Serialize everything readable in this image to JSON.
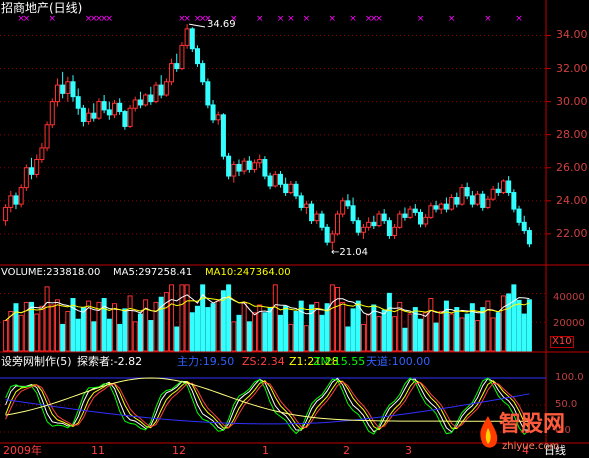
{
  "window": {
    "title": "招商地产(日线)"
  },
  "colors": {
    "up": "#ff3333",
    "down": "#33ffff",
    "grid": "#8b0000",
    "axis": "#c00000",
    "ma5": "#ffffff",
    "ma10": "#ffff00",
    "marker": "#ff00ff",
    "k": "#ffffff",
    "d": "#ffff00",
    "j": "#ff00ff",
    "z1": "#00ff00",
    "zm": "#ff4040",
    "ave": "#3030ff"
  },
  "price_panel": {
    "ticks": [
      "34.00",
      "32.00",
      "30.00",
      "28.00",
      "26.00",
      "24.00",
      "22.00"
    ],
    "high_label": "34.69",
    "low_label": "←21.04"
  },
  "volume_panel": {
    "label": "VOLUME:233818.00",
    "ma5_label": "MA5:297258.41",
    "ma10_label": "MA10:247364.00",
    "ticks": [
      "40000",
      "20000"
    ],
    "unit": "X10"
  },
  "indicator_panel": {
    "name": "设旁网制作(5)",
    "tansuo": "探索者:-2.82",
    "zhuli": "主力:19.50",
    "zs": "ZS:2.34",
    "z1": "Z1:21.28",
    "zm": "ZM:15.55",
    "tiandi": "天道:100.00",
    "ticks": [
      "100.0",
      "50.0",
      "0.0"
    ]
  },
  "time_axis": {
    "labels": [
      "2009年",
      "11",
      "12",
      "1",
      "2",
      "3",
      "4"
    ],
    "period": "日线"
  },
  "watermark": {
    "brand": "智股网",
    "url": "zhiyue.com"
  },
  "chart_data": {
    "type": "candlestick",
    "title": "招商地产(日线)",
    "price_range": [
      20.3,
      35.3
    ],
    "y_ticks": [
      34,
      32,
      30,
      28,
      26,
      24,
      22
    ],
    "highest": 34.69,
    "lowest": 21.04,
    "candles": [
      {
        "o": 22.8,
        "h": 23.8,
        "l": 22.5,
        "c": 23.6
      },
      {
        "o": 23.6,
        "h": 24.6,
        "l": 23.3,
        "c": 24.3
      },
      {
        "o": 24.3,
        "h": 24.5,
        "l": 23.5,
        "c": 23.8
      },
      {
        "o": 23.8,
        "h": 25.0,
        "l": 23.6,
        "c": 24.8
      },
      {
        "o": 24.8,
        "h": 26.2,
        "l": 24.6,
        "c": 26.0
      },
      {
        "o": 26.0,
        "h": 26.6,
        "l": 25.3,
        "c": 25.6
      },
      {
        "o": 25.6,
        "h": 26.8,
        "l": 25.4,
        "c": 26.5
      },
      {
        "o": 26.5,
        "h": 27.5,
        "l": 26.3,
        "c": 27.2
      },
      {
        "o": 27.2,
        "h": 28.8,
        "l": 27.0,
        "c": 28.6
      },
      {
        "o": 28.6,
        "h": 30.2,
        "l": 28.4,
        "c": 30.0
      },
      {
        "o": 30.0,
        "h": 31.4,
        "l": 29.7,
        "c": 31.0
      },
      {
        "o": 31.0,
        "h": 31.8,
        "l": 30.2,
        "c": 30.5
      },
      {
        "o": 30.5,
        "h": 31.5,
        "l": 30.0,
        "c": 31.2
      },
      {
        "o": 31.2,
        "h": 31.6,
        "l": 30.0,
        "c": 30.3
      },
      {
        "o": 30.3,
        "h": 30.8,
        "l": 29.2,
        "c": 29.6
      },
      {
        "o": 29.6,
        "h": 29.8,
        "l": 28.5,
        "c": 28.8
      },
      {
        "o": 28.8,
        "h": 29.6,
        "l": 28.6,
        "c": 29.3
      },
      {
        "o": 29.3,
        "h": 29.9,
        "l": 28.8,
        "c": 29.0
      },
      {
        "o": 29.0,
        "h": 30.2,
        "l": 28.9,
        "c": 30.0
      },
      {
        "o": 30.0,
        "h": 30.4,
        "l": 29.3,
        "c": 29.5
      },
      {
        "o": 29.5,
        "h": 30.0,
        "l": 28.9,
        "c": 29.2
      },
      {
        "o": 29.2,
        "h": 30.1,
        "l": 29.0,
        "c": 29.9
      },
      {
        "o": 29.9,
        "h": 30.2,
        "l": 29.2,
        "c": 29.4
      },
      {
        "o": 29.4,
        "h": 29.5,
        "l": 28.3,
        "c": 28.5
      },
      {
        "o": 28.5,
        "h": 29.8,
        "l": 28.4,
        "c": 29.6
      },
      {
        "o": 29.6,
        "h": 30.3,
        "l": 29.4,
        "c": 30.1
      },
      {
        "o": 30.1,
        "h": 30.6,
        "l": 29.6,
        "c": 29.8
      },
      {
        "o": 29.8,
        "h": 30.5,
        "l": 29.7,
        "c": 30.4
      },
      {
        "o": 30.4,
        "h": 30.9,
        "l": 29.8,
        "c": 30.0
      },
      {
        "o": 30.0,
        "h": 31.2,
        "l": 29.9,
        "c": 31.0
      },
      {
        "o": 31.0,
        "h": 31.6,
        "l": 30.2,
        "c": 30.4
      },
      {
        "o": 30.4,
        "h": 31.4,
        "l": 30.3,
        "c": 31.2
      },
      {
        "o": 31.2,
        "h": 32.6,
        "l": 31.0,
        "c": 32.3
      },
      {
        "o": 32.3,
        "h": 32.9,
        "l": 31.8,
        "c": 32.0
      },
      {
        "o": 32.0,
        "h": 33.6,
        "l": 31.9,
        "c": 33.4
      },
      {
        "o": 33.4,
        "h": 34.69,
        "l": 33.2,
        "c": 34.4
      },
      {
        "o": 34.4,
        "h": 34.5,
        "l": 33.0,
        "c": 33.2
      },
      {
        "o": 33.2,
        "h": 33.4,
        "l": 32.1,
        "c": 32.3
      },
      {
        "o": 32.3,
        "h": 32.5,
        "l": 31.0,
        "c": 31.2
      },
      {
        "o": 31.2,
        "h": 31.4,
        "l": 29.6,
        "c": 29.8
      },
      {
        "o": 29.8,
        "h": 30.1,
        "l": 28.7,
        "c": 28.9
      },
      {
        "o": 28.9,
        "h": 29.4,
        "l": 28.6,
        "c": 29.2
      },
      {
        "o": 29.2,
        "h": 29.3,
        "l": 26.5,
        "c": 26.7
      },
      {
        "o": 26.7,
        "h": 26.9,
        "l": 25.3,
        "c": 25.5
      },
      {
        "o": 25.5,
        "h": 26.4,
        "l": 25.1,
        "c": 26.2
      },
      {
        "o": 26.2,
        "h": 26.5,
        "l": 25.5,
        "c": 25.8
      },
      {
        "o": 25.8,
        "h": 26.6,
        "l": 25.6,
        "c": 26.4
      },
      {
        "o": 26.4,
        "h": 26.7,
        "l": 25.7,
        "c": 25.9
      },
      {
        "o": 25.9,
        "h": 26.5,
        "l": 25.7,
        "c": 26.3
      },
      {
        "o": 26.3,
        "h": 26.8,
        "l": 26.0,
        "c": 26.5
      },
      {
        "o": 26.5,
        "h": 26.7,
        "l": 25.3,
        "c": 25.5
      },
      {
        "o": 25.5,
        "h": 25.7,
        "l": 24.7,
        "c": 24.9
      },
      {
        "o": 24.9,
        "h": 25.8,
        "l": 24.8,
        "c": 25.6
      },
      {
        "o": 25.6,
        "h": 25.8,
        "l": 24.8,
        "c": 25.0
      },
      {
        "o": 25.0,
        "h": 25.4,
        "l": 24.3,
        "c": 24.5
      },
      {
        "o": 24.5,
        "h": 25.2,
        "l": 24.4,
        "c": 25.0
      },
      {
        "o": 25.0,
        "h": 25.2,
        "l": 24.1,
        "c": 24.3
      },
      {
        "o": 24.3,
        "h": 24.5,
        "l": 23.4,
        "c": 23.6
      },
      {
        "o": 23.6,
        "h": 24.0,
        "l": 23.2,
        "c": 23.8
      },
      {
        "o": 23.8,
        "h": 24.0,
        "l": 22.6,
        "c": 22.8
      },
      {
        "o": 22.8,
        "h": 23.4,
        "l": 22.6,
        "c": 23.2
      },
      {
        "o": 23.2,
        "h": 23.4,
        "l": 22.2,
        "c": 22.4
      },
      {
        "o": 22.4,
        "h": 22.6,
        "l": 21.3,
        "c": 21.5
      },
      {
        "o": 21.5,
        "h": 22.2,
        "l": 21.04,
        "c": 22.0
      },
      {
        "o": 22.0,
        "h": 23.4,
        "l": 21.9,
        "c": 23.2
      },
      {
        "o": 23.2,
        "h": 24.2,
        "l": 23.0,
        "c": 24.0
      },
      {
        "o": 24.0,
        "h": 24.4,
        "l": 23.5,
        "c": 23.7
      },
      {
        "o": 23.7,
        "h": 24.2,
        "l": 22.6,
        "c": 22.8
      },
      {
        "o": 22.8,
        "h": 23.0,
        "l": 21.9,
        "c": 22.1
      },
      {
        "o": 22.1,
        "h": 22.6,
        "l": 21.7,
        "c": 22.4
      },
      {
        "o": 22.4,
        "h": 23.0,
        "l": 22.2,
        "c": 22.7
      },
      {
        "o": 22.7,
        "h": 23.1,
        "l": 22.3,
        "c": 22.5
      },
      {
        "o": 22.5,
        "h": 23.4,
        "l": 22.4,
        "c": 23.2
      },
      {
        "o": 23.2,
        "h": 23.5,
        "l": 22.6,
        "c": 22.8
      },
      {
        "o": 22.8,
        "h": 23.0,
        "l": 21.7,
        "c": 21.9
      },
      {
        "o": 21.9,
        "h": 22.6,
        "l": 21.7,
        "c": 22.4
      },
      {
        "o": 22.4,
        "h": 23.4,
        "l": 22.3,
        "c": 23.2
      },
      {
        "o": 23.2,
        "h": 23.6,
        "l": 22.8,
        "c": 23.0
      },
      {
        "o": 23.0,
        "h": 23.7,
        "l": 22.9,
        "c": 23.5
      },
      {
        "o": 23.5,
        "h": 23.8,
        "l": 23.1,
        "c": 23.3
      },
      {
        "o": 23.3,
        "h": 23.5,
        "l": 22.4,
        "c": 22.6
      },
      {
        "o": 22.6,
        "h": 23.2,
        "l": 22.4,
        "c": 23.0
      },
      {
        "o": 23.0,
        "h": 23.9,
        "l": 22.9,
        "c": 23.7
      },
      {
        "o": 23.7,
        "h": 24.0,
        "l": 23.3,
        "c": 23.5
      },
      {
        "o": 23.5,
        "h": 23.9,
        "l": 23.2,
        "c": 23.8
      },
      {
        "o": 23.8,
        "h": 24.2,
        "l": 23.3,
        "c": 23.5
      },
      {
        "o": 23.5,
        "h": 24.4,
        "l": 23.4,
        "c": 24.2
      },
      {
        "o": 24.2,
        "h": 24.5,
        "l": 23.6,
        "c": 23.8
      },
      {
        "o": 23.8,
        "h": 25.0,
        "l": 23.7,
        "c": 24.8
      },
      {
        "o": 24.8,
        "h": 25.1,
        "l": 24.1,
        "c": 24.3
      },
      {
        "o": 24.3,
        "h": 24.6,
        "l": 23.6,
        "c": 23.8
      },
      {
        "o": 23.8,
        "h": 24.6,
        "l": 23.7,
        "c": 24.4
      },
      {
        "o": 24.4,
        "h": 24.6,
        "l": 23.4,
        "c": 23.6
      },
      {
        "o": 23.6,
        "h": 24.3,
        "l": 23.5,
        "c": 24.1
      },
      {
        "o": 24.1,
        "h": 24.9,
        "l": 24.0,
        "c": 24.7
      },
      {
        "o": 24.7,
        "h": 25.1,
        "l": 24.3,
        "c": 24.5
      },
      {
        "o": 24.5,
        "h": 25.3,
        "l": 24.4,
        "c": 25.2
      },
      {
        "o": 25.2,
        "h": 25.5,
        "l": 24.3,
        "c": 24.5
      },
      {
        "o": 24.5,
        "h": 24.7,
        "l": 23.3,
        "c": 23.5
      },
      {
        "o": 23.5,
        "h": 23.7,
        "l": 22.5,
        "c": 22.7
      },
      {
        "o": 22.7,
        "h": 23.1,
        "l": 22.0,
        "c": 22.2
      },
      {
        "o": 22.2,
        "h": 22.4,
        "l": 21.2,
        "c": 21.4
      }
    ],
    "volume": {
      "ticks": [
        40000,
        20000
      ],
      "range": [
        0,
        48000
      ],
      "unit": "X10",
      "last": 233818.0,
      "ma5": 297258.41,
      "ma10": 247364.0
    },
    "indicator": {
      "name": "设旁网制作(5)",
      "range": [
        0,
        100
      ],
      "ticks": [
        100,
        50,
        0
      ],
      "values": {
        "探索者": -2.82,
        "主力": 19.5,
        "ZS": 2.34,
        "Z1": 21.28,
        "ZM": 15.55,
        "天道": 100.0
      }
    }
  }
}
